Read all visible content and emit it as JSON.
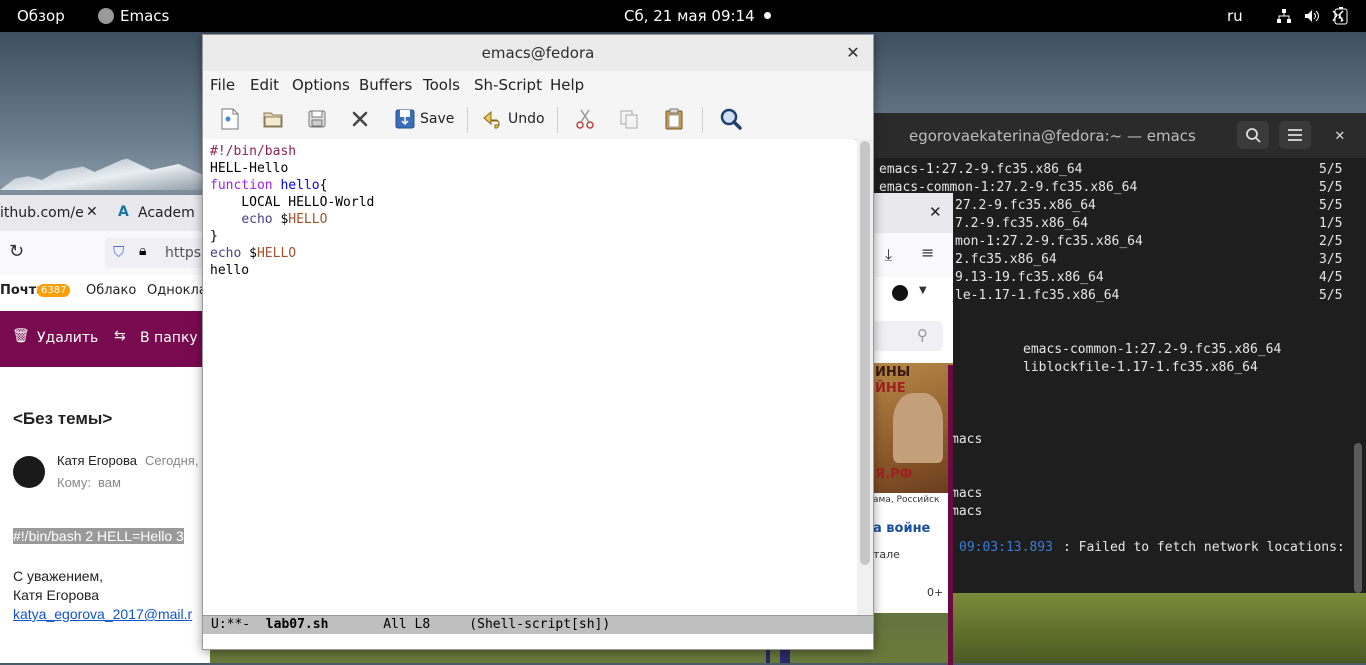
{
  "topbar": {
    "overview": "Обзор",
    "app_name": "Emacs",
    "datetime": "Сб, 21 мая  09:14",
    "lang": "ru"
  },
  "browser": {
    "tab1": "ithub.com/e",
    "tab2": "Academ",
    "url": "https",
    "bookmarks": [
      "Почта",
      "Облако",
      "Однокла"
    ],
    "mail_badge": "6387",
    "delete_label": "Удалить",
    "move_label": "В папку",
    "subject": "<Без темы>",
    "sender": "Катя Егорова",
    "date": "Сегодня,",
    "to_label": "Кому:",
    "to_value": "вам",
    "body_highlight": "#!/bin/bash 2 HELL=Hello 3",
    "regards": "С уважением,",
    "signature_name": "Катя Егорова",
    "email_link": "katya_egorova_2017@mail.r"
  },
  "terminal": {
    "title": "egorovaekaterina@fedora:~ — emacs",
    "lines": [
      {
        "text": "emacs-1:27.2-9.fc35.x86_64",
        "num": "5/5"
      },
      {
        "text": "emacs-common-1:27.2-9.fc35.x86_64",
        "num": "5/5"
      },
      {
        "text": "27.2-9.fc35.x86_64",
        "num": "5/5"
      },
      {
        "text": "7.2-9.fc35.x86_64",
        "num": "1/5"
      },
      {
        "text": "mon-1:27.2-9.fc35.x86_64",
        "num": "2/5"
      },
      {
        "text": "2.fc35.x86_64",
        "num": "3/5"
      },
      {
        "text": "9.13-19.fc35.x86_64",
        "num": "4/5"
      },
      {
        "text": "le-1.17-1.fc35.x86_64",
        "num": "5/5"
      }
    ],
    "installed1": "emacs-common-1:27.2-9.fc35.x86_64",
    "installed2": "liblockfile-1.17-1.fc35.x86_64",
    "emacs1": "macs",
    "emacs2": "macs",
    "emacs3": "macs",
    "log_time": "09:03:13.893",
    "log_msg": ": Failed to fetch network locations:"
  },
  "ff2": {
    "ad_text1": "ИНЫ",
    "ad_text2": "ЙНЕ",
    "ad_text3": "Я.РФ",
    "caption": "ама, Российск",
    "link": "а войне",
    "small": "тале",
    "age": "0+"
  },
  "emacs": {
    "title": "emacs@fedora",
    "menu": [
      "File",
      "Edit",
      "Options",
      "Buffers",
      "Tools",
      "Sh-Script",
      "Help"
    ],
    "toolbar": {
      "save": "Save",
      "undo": "Undo"
    },
    "code": {
      "shebang": "#!/bin/bash",
      "line2": "HELL-Hello",
      "function_kw": "function",
      "function_name": "hello",
      "brace_open": "{",
      "line4": "    LOCAL HELLO-World",
      "echo_kw": "echo",
      "echo_indent": "    ",
      "dollar": " $",
      "var_hello": "HELLO",
      "brace_close": "}",
      "line8": "hello"
    },
    "modeline": "U:**-  ",
    "filename": "lab07.sh",
    "modeline_rest": "       All L8     (Shell-script[sh])"
  }
}
